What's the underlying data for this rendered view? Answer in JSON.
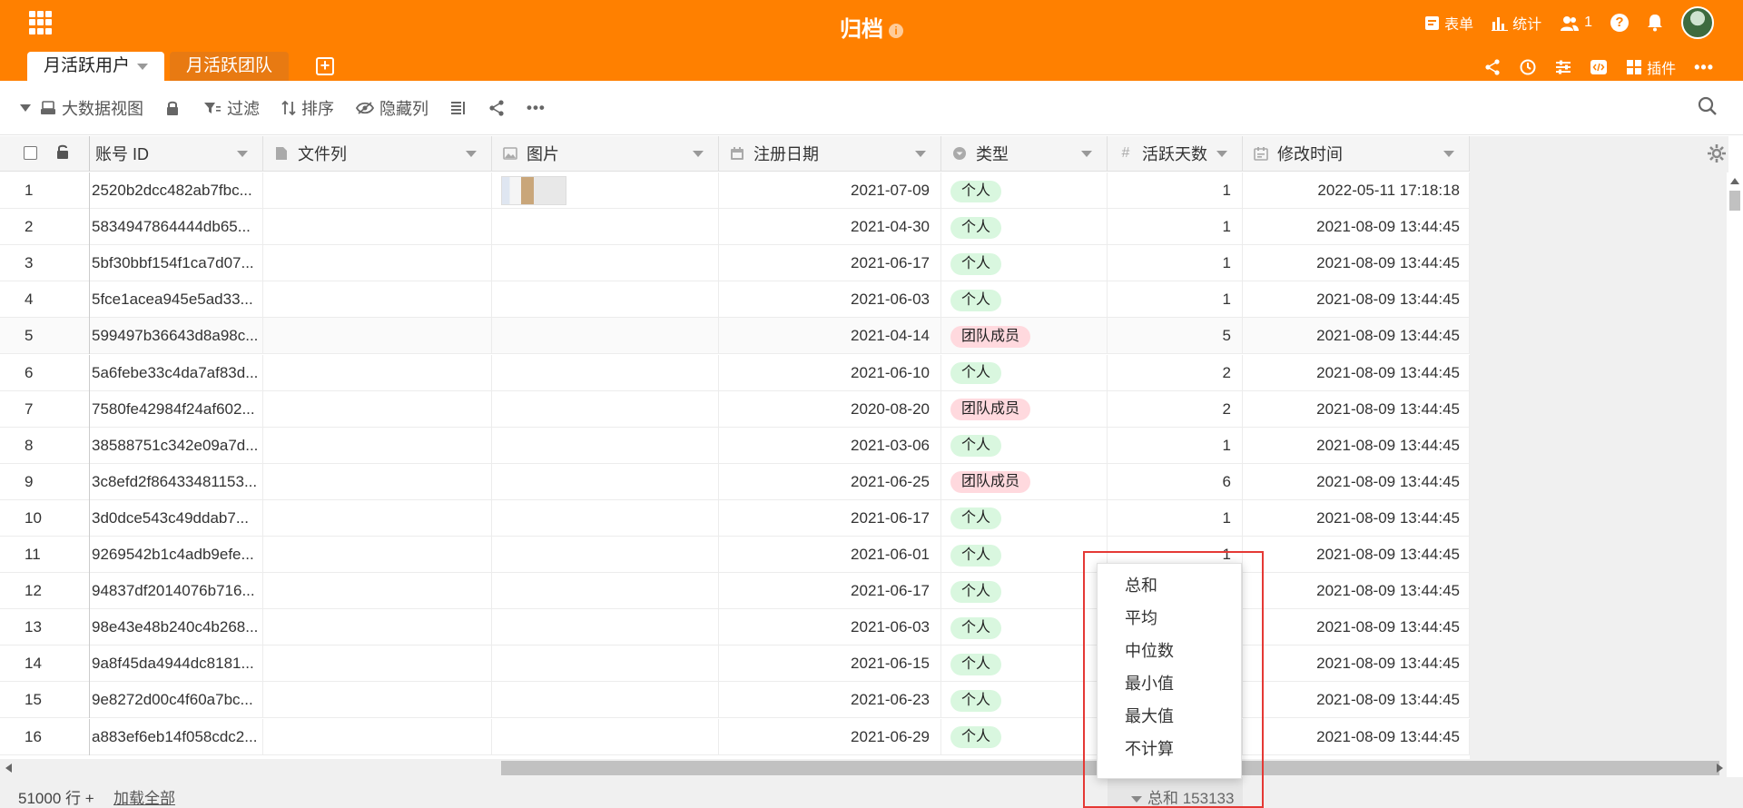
{
  "header": {
    "title": "归档",
    "right_items": [
      {
        "icon": "form-icon",
        "label": "表单"
      },
      {
        "icon": "statistics-icon",
        "label": "统计"
      },
      {
        "icon": "users-icon",
        "label": "1"
      }
    ]
  },
  "tabs": [
    {
      "label": "月活跃用户",
      "active": true
    },
    {
      "label": "月活跃团队",
      "active": false
    }
  ],
  "tab_tools": {
    "plugin_label": "插件"
  },
  "toolbar": {
    "view_label": "大数据视图",
    "filter_label": "过滤",
    "sort_label": "排序",
    "hide_label": "隐藏列"
  },
  "columns": [
    {
      "label": "账号 ID",
      "icon": "text-column-icon"
    },
    {
      "label": "文件列",
      "icon": "file-column-icon"
    },
    {
      "label": "图片",
      "icon": "image-column-icon"
    },
    {
      "label": "注册日期",
      "icon": "date-column-icon"
    },
    {
      "label": "类型",
      "icon": "select-column-icon"
    },
    {
      "label": "活跃天数",
      "icon": "number-column-icon"
    },
    {
      "label": "修改时间",
      "icon": "mtime-column-icon"
    }
  ],
  "rows": [
    {
      "n": "1",
      "id": "2520b2dcc482ab7fbc...",
      "has_image": true,
      "date": "2021-07-09",
      "type": "个人",
      "days": "1",
      "mtime": "2022-05-11 17:18:18"
    },
    {
      "n": "2",
      "id": "5834947864444db65...",
      "has_image": false,
      "date": "2021-04-30",
      "type": "个人",
      "days": "1",
      "mtime": "2021-08-09 13:44:45"
    },
    {
      "n": "3",
      "id": "5bf30bbf154f1ca7d07...",
      "has_image": false,
      "date": "2021-06-17",
      "type": "个人",
      "days": "1",
      "mtime": "2021-08-09 13:44:45"
    },
    {
      "n": "4",
      "id": "5fce1acea945e5ad33...",
      "has_image": false,
      "date": "2021-06-03",
      "type": "个人",
      "days": "1",
      "mtime": "2021-08-09 13:44:45"
    },
    {
      "n": "5",
      "id": "599497b36643d8a98c...",
      "has_image": false,
      "date": "2021-04-14",
      "type": "团队成员",
      "days": "5",
      "mtime": "2021-08-09 13:44:45"
    },
    {
      "n": "6",
      "id": "5a6febe33c4da7af83d...",
      "has_image": false,
      "date": "2021-06-10",
      "type": "个人",
      "days": "2",
      "mtime": "2021-08-09 13:44:45"
    },
    {
      "n": "7",
      "id": "7580fe42984f24af602...",
      "has_image": false,
      "date": "2020-08-20",
      "type": "团队成员",
      "days": "2",
      "mtime": "2021-08-09 13:44:45"
    },
    {
      "n": "8",
      "id": "38588751c342e09a7d...",
      "has_image": false,
      "date": "2021-03-06",
      "type": "个人",
      "days": "1",
      "mtime": "2021-08-09 13:44:45"
    },
    {
      "n": "9",
      "id": "3c8efd2f86433481153...",
      "has_image": false,
      "date": "2021-06-25",
      "type": "团队成员",
      "days": "6",
      "mtime": "2021-08-09 13:44:45"
    },
    {
      "n": "10",
      "id": "3d0dce543c49ddab7...",
      "has_image": false,
      "date": "2021-06-17",
      "type": "个人",
      "days": "1",
      "mtime": "2021-08-09 13:44:45"
    },
    {
      "n": "11",
      "id": "9269542b1c4adb9efe...",
      "has_image": false,
      "date": "2021-06-01",
      "type": "个人",
      "days": "1",
      "mtime": "2021-08-09 13:44:45"
    },
    {
      "n": "12",
      "id": "94837df2014076b716...",
      "has_image": false,
      "date": "2021-06-17",
      "type": "个人",
      "days": "",
      "mtime": "2021-08-09 13:44:45"
    },
    {
      "n": "13",
      "id": "98e43e48b240c4b268...",
      "has_image": false,
      "date": "2021-06-03",
      "type": "个人",
      "days": "",
      "mtime": "2021-08-09 13:44:45"
    },
    {
      "n": "14",
      "id": "9a8f45da4944dc8181...",
      "has_image": false,
      "date": "2021-06-15",
      "type": "个人",
      "days": "",
      "mtime": "2021-08-09 13:44:45"
    },
    {
      "n": "15",
      "id": "9e8272d00c4f60a7bc...",
      "has_image": false,
      "date": "2021-06-23",
      "type": "个人",
      "days": "",
      "mtime": "2021-08-09 13:44:45"
    },
    {
      "n": "16",
      "id": "a883ef6eb14f058cdc2...",
      "has_image": false,
      "date": "2021-06-29",
      "type": "个人",
      "days": "",
      "mtime": "2021-08-09 13:44:45"
    }
  ],
  "type_colors": {
    "个人": {
      "bg": "#d9f7df",
      "fg": "#222222"
    },
    "团队成员": {
      "bg": "#ffd9de",
      "fg": "#222222"
    }
  },
  "footer": {
    "row_count": "51000 行 +",
    "load_all": "加载全部",
    "aggregate": "总和 153133"
  },
  "aggregate_menu": {
    "options": [
      "总和",
      "平均",
      "中位数",
      "最小值",
      "最大值",
      "不计算"
    ]
  },
  "colors": {
    "brand": "#ff8000",
    "highlight_box": "#e53935"
  }
}
